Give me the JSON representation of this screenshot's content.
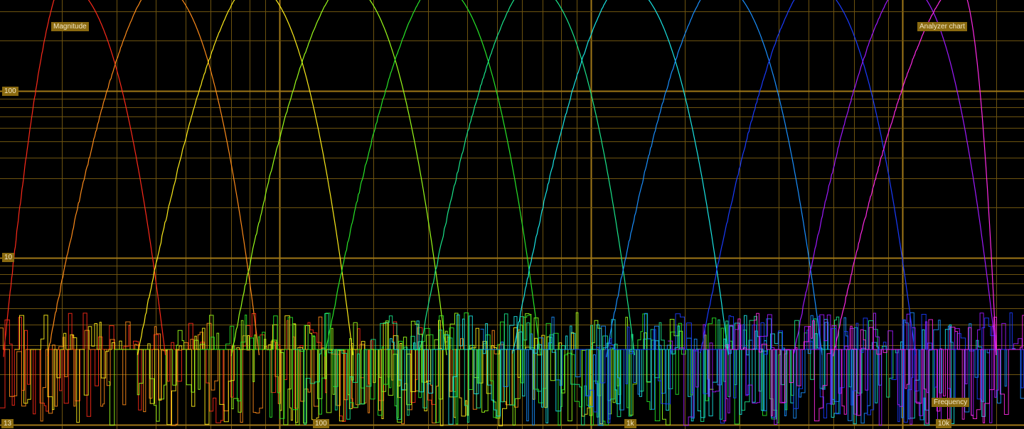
{
  "chart_data": {
    "type": "line",
    "title": "Analyzer chart",
    "ylabel": "Magnitude",
    "xlabel": "Frequency",
    "x_scale": "log",
    "y_scale": "log",
    "xlim": [
      13,
      20000
    ],
    "ylim": [
      0.9,
      600
    ],
    "x_tick_labels": [
      {
        "value": 13,
        "label": "13"
      },
      {
        "value": 100,
        "label": "100"
      },
      {
        "value": 1000,
        "label": "1k"
      },
      {
        "value": 10000,
        "label": "10k"
      }
    ],
    "y_tick_labels": [
      {
        "value": 100,
        "label": "100"
      },
      {
        "value": 10,
        "label": "10"
      }
    ],
    "grid": true,
    "legend": "none",
    "colors": {
      "background": "#000000",
      "grid_major": "#a07818",
      "grid_minor": "#6e5410",
      "label_bg": "#8a6a10",
      "label_text": "#f2e6c4"
    },
    "series": [
      {
        "color": "#ff2a1a",
        "peak_freq": 20,
        "peak_magnitude": 440,
        "min_freq": 13,
        "max_freq": 43
      },
      {
        "color": "#ff8c1a",
        "peak_freq": 40,
        "peak_magnitude": 440,
        "min_freq": 18,
        "max_freq": 86
      },
      {
        "color": "#ffee1a",
        "peak_freq": 80,
        "peak_magnitude": 440,
        "min_freq": 35,
        "max_freq": 172
      },
      {
        "color": "#9cff1a",
        "peak_freq": 160,
        "peak_magnitude": 440,
        "min_freq": 70,
        "max_freq": 344
      },
      {
        "color": "#28e628",
        "peak_freq": 315,
        "peak_magnitude": 440,
        "min_freq": 140,
        "max_freq": 688
      },
      {
        "color": "#1ae68c",
        "peak_freq": 630,
        "peak_magnitude": 440,
        "min_freq": 280,
        "max_freq": 1380
      },
      {
        "color": "#1ae6e6",
        "peak_freq": 1250,
        "peak_magnitude": 440,
        "min_freq": 560,
        "max_freq": 2760
      },
      {
        "color": "#1a90ff",
        "peak_freq": 2500,
        "peak_magnitude": 440,
        "min_freq": 1120,
        "max_freq": 5520
      },
      {
        "color": "#1a3cff",
        "peak_freq": 5000,
        "peak_magnitude": 440,
        "min_freq": 2240,
        "max_freq": 11000
      },
      {
        "color": "#a01aff",
        "peak_freq": 10000,
        "peak_magnitude": 440,
        "min_freq": 4480,
        "max_freq": 20000
      },
      {
        "color": "#ff2ae6",
        "peak_freq": 15000,
        "peak_magnitude": 440,
        "min_freq": 6000,
        "max_freq": 20000
      }
    ]
  }
}
